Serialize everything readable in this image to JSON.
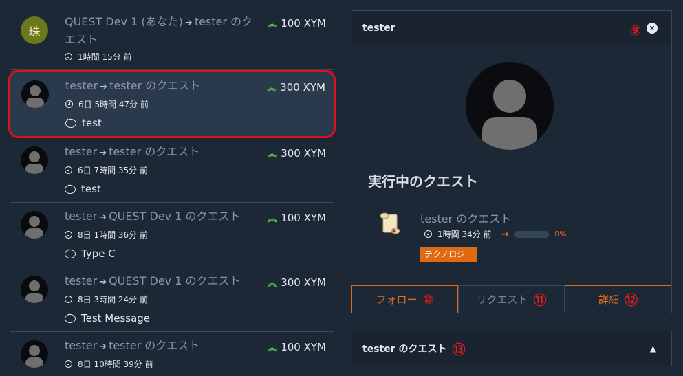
{
  "feed": [
    {
      "from": "QUEST Dev 1 (あなた)",
      "to": "tester のクエスト",
      "amount": "100 XYM",
      "time": "1時間 15分 前",
      "message": "",
      "avatar": "logo"
    },
    {
      "from": "tester",
      "to": "tester のクエスト",
      "amount": "300 XYM",
      "time": "6日 5時間 47分 前",
      "message": "test",
      "avatar": "person"
    },
    {
      "from": "tester",
      "to": "tester のクエスト",
      "amount": "300 XYM",
      "time": "6日 7時間 35分 前",
      "message": "test",
      "avatar": "person"
    },
    {
      "from": "tester",
      "to": "QUEST Dev 1 のクエスト",
      "amount": "100 XYM",
      "time": "8日 1時間 36分 前",
      "message": "Type C",
      "avatar": "person"
    },
    {
      "from": "tester",
      "to": "QUEST Dev 1 のクエスト",
      "amount": "300 XYM",
      "time": "8日 3時間 24分 前",
      "message": "Test Message",
      "avatar": "person"
    },
    {
      "from": "tester",
      "to": "tester のクエスト",
      "amount": "100 XYM",
      "time": "8日 10時間 39分 前",
      "message": "",
      "avatar": "person"
    }
  ],
  "logo_char": "珠",
  "panel": {
    "user_name": "tester",
    "marker_close": "⑨",
    "section_title": "実行中のクエスト",
    "quest": {
      "name": "tester のクエスト",
      "time": "1時間 34分 前",
      "progress_label": "0%",
      "progress": 0,
      "tag": "テクノロジー"
    },
    "buttons": {
      "follow": "フォロー",
      "follow_marker": "⑩",
      "request": "リクエスト",
      "request_marker": "⑪",
      "details": "詳細",
      "details_marker": "⑫"
    }
  },
  "accordion": {
    "title": "tester のクエスト",
    "marker": "⑬"
  },
  "colors": {
    "accent": "#e46b16",
    "amount_chevron": "#59c14e",
    "highlight_border": "#e0101a"
  }
}
